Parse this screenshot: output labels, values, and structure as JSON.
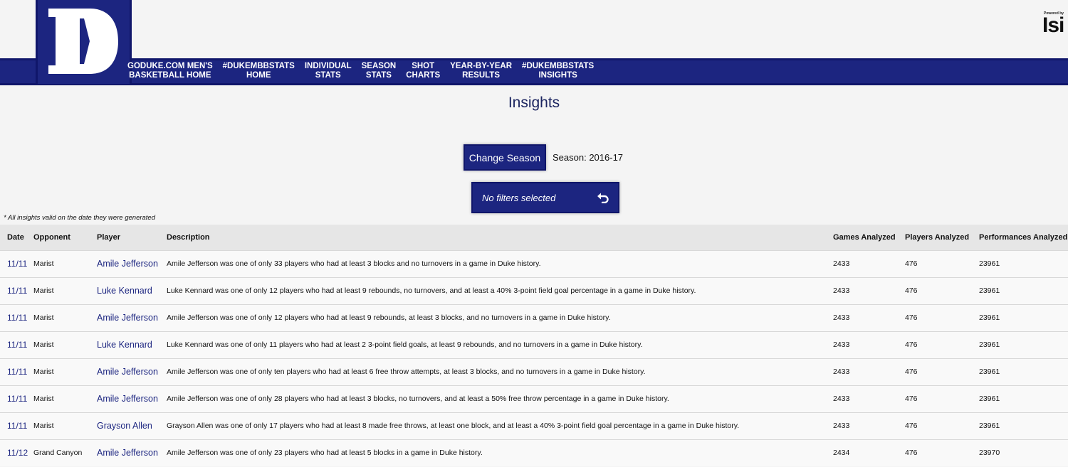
{
  "header": {
    "logo_letter": "D",
    "nav": [
      "GODUKE.COM MEN'S\nBASKETBALL HOME",
      "#DUKEMBBSTATS\nHOME",
      "INDIVIDUAL\nSTATS",
      "SEASON\nSTATS",
      "SHOT\nCHARTS",
      "YEAR-BY-YEAR\nRESULTS",
      "#DUKEMBBSTATS\nINSIGHTS"
    ],
    "powered_small": "Powered by",
    "powered_brand": "Isi"
  },
  "page": {
    "title": "Insights",
    "change_season_label": "Change Season",
    "season_label": "Season: 2016-17",
    "filter_text": "No filters selected",
    "note": "* All insights valid on the date they were generated"
  },
  "colors": {
    "navy": "#1c2580",
    "link": "#1c2580"
  },
  "table": {
    "headers": [
      "Date",
      "Opponent",
      "Player",
      "Description",
      "Games Analyzed",
      "Players Analyzed",
      "Performances Analyzed"
    ],
    "rows": [
      {
        "date": "11/11",
        "opponent": "Marist",
        "player": "Amile Jefferson",
        "description": "Amile Jefferson was one of only 33 players who had at least 3 blocks and no turnovers in a game in Duke history.",
        "games": "2433",
        "players": "476",
        "performances": "23961"
      },
      {
        "date": "11/11",
        "opponent": "Marist",
        "player": "Luke Kennard",
        "description": "Luke Kennard was one of only 12 players who had at least 9 rebounds, no turnovers, and at least a 40% 3-point field goal percentage in a game in Duke history.",
        "games": "2433",
        "players": "476",
        "performances": "23961"
      },
      {
        "date": "11/11",
        "opponent": "Marist",
        "player": "Amile Jefferson",
        "description": "Amile Jefferson was one of only 12 players who had at least 9 rebounds, at least 3 blocks, and no turnovers in a game in Duke history.",
        "games": "2433",
        "players": "476",
        "performances": "23961"
      },
      {
        "date": "11/11",
        "opponent": "Marist",
        "player": "Luke Kennard",
        "description": "Luke Kennard was one of only 11 players who had at least 2 3-point field goals, at least 9 rebounds, and no turnovers in a game in Duke history.",
        "games": "2433",
        "players": "476",
        "performances": "23961"
      },
      {
        "date": "11/11",
        "opponent": "Marist",
        "player": "Amile Jefferson",
        "description": "Amile Jefferson was one of only ten players who had at least 6 free throw attempts, at least 3 blocks, and no turnovers in a game in Duke history.",
        "games": "2433",
        "players": "476",
        "performances": "23961"
      },
      {
        "date": "11/11",
        "opponent": "Marist",
        "player": "Amile Jefferson",
        "description": "Amile Jefferson was one of only 28 players who had at least 3 blocks, no turnovers, and at least a 50% free throw percentage in a game in Duke history.",
        "games": "2433",
        "players": "476",
        "performances": "23961"
      },
      {
        "date": "11/11",
        "opponent": "Marist",
        "player": "Grayson Allen",
        "description": "Grayson Allen was one of only 17 players who had at least 8 made free throws, at least one block, and at least a 40% 3-point field goal percentage in a game in Duke history.",
        "games": "2433",
        "players": "476",
        "performances": "23961"
      },
      {
        "date": "11/12",
        "opponent": "Grand Canyon",
        "player": "Amile Jefferson",
        "description": "Amile Jefferson was one of only 23 players who had at least 5 blocks in a game in Duke history.",
        "games": "2434",
        "players": "476",
        "performances": "23970"
      }
    ]
  }
}
